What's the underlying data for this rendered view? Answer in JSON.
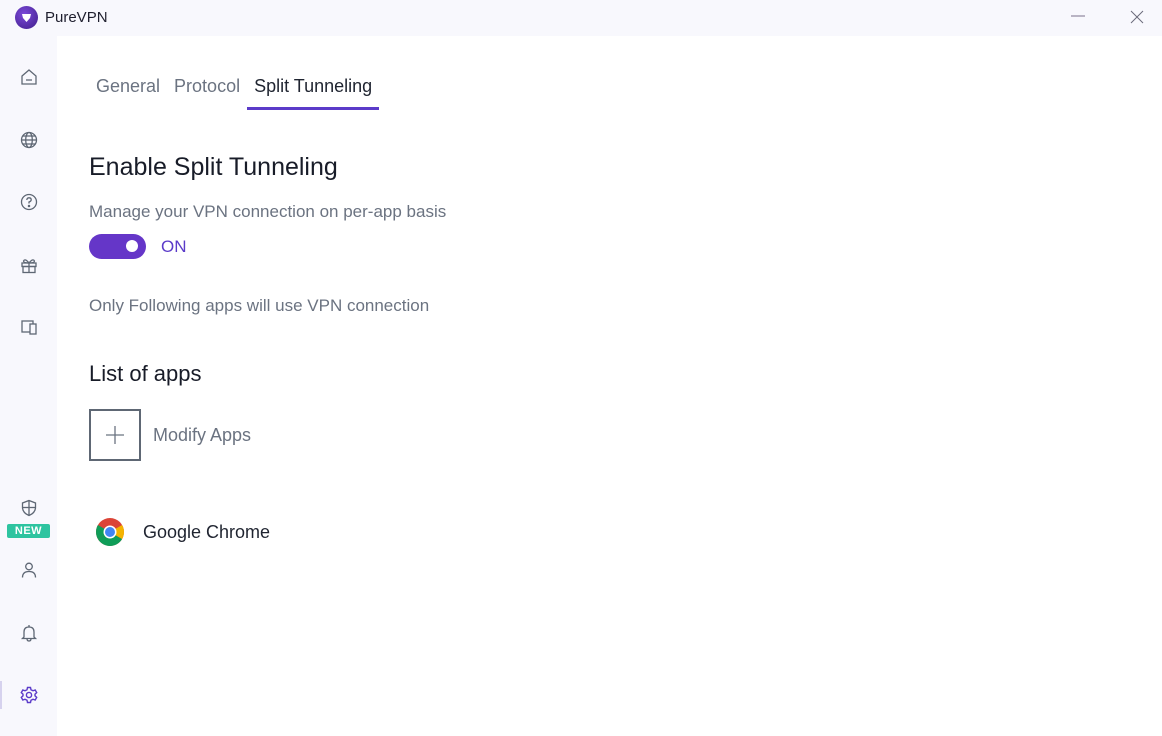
{
  "window": {
    "title": "PureVPN",
    "minimize_icon": "minimize-icon",
    "close_icon": "close-icon"
  },
  "sidebar": {
    "items": [
      {
        "name": "home",
        "icon": "home-icon"
      },
      {
        "name": "locations",
        "icon": "globe-icon"
      },
      {
        "name": "help",
        "icon": "help-circle-icon"
      },
      {
        "name": "rewards",
        "icon": "gift-icon"
      },
      {
        "name": "devices",
        "icon": "devices-icon"
      },
      {
        "name": "security",
        "icon": "shield-icon",
        "badge": "NEW"
      },
      {
        "name": "account",
        "icon": "user-icon"
      },
      {
        "name": "notifications",
        "icon": "bell-icon"
      },
      {
        "name": "settings",
        "icon": "gear-icon",
        "active": true
      }
    ],
    "badge_new": "NEW"
  },
  "tabs": [
    {
      "label": "General",
      "active": false
    },
    {
      "label": "Protocol",
      "active": false
    },
    {
      "label": "Split Tunneling",
      "active": true
    }
  ],
  "split_tunneling": {
    "title": "Enable Split Tunneling",
    "description": "Manage your VPN connection on per-app basis",
    "toggle_state": "ON",
    "toggle_on": true,
    "mode_note": "Only Following apps will use VPN connection",
    "list_title": "List of apps",
    "modify_label": "Modify Apps",
    "apps": [
      {
        "name": "Google Chrome",
        "icon": "chrome-icon"
      }
    ]
  },
  "colors": {
    "accent": "#5b3bc9",
    "toggle": "#6536c8",
    "badge": "#2ec4a0",
    "sidebar_bg": "#f8f8fd"
  }
}
